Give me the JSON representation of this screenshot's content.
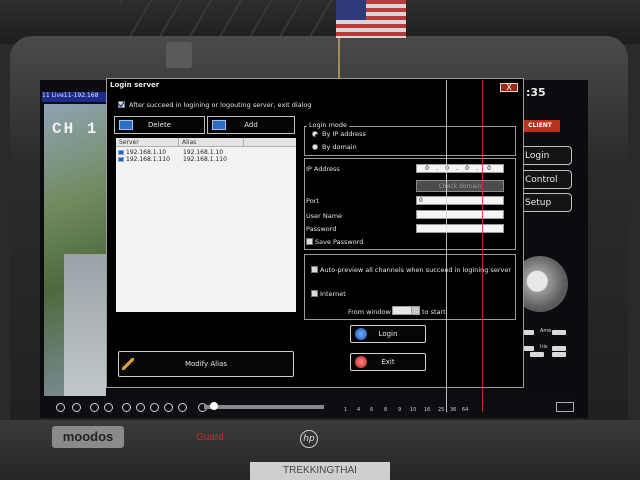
{
  "background_app": {
    "cam_title": "11 Live11-192.168",
    "channel_label": "CH 1",
    "time": ":35",
    "client_logo": "CLIENT",
    "side_buttons": [
      "Login",
      "Control",
      "Setup"
    ],
    "keypad_labels": [
      "Ame",
      "Iris"
    ],
    "grid_numbers": [
      "1",
      "4",
      "6",
      "8",
      "9",
      "10",
      "16",
      "25",
      "36",
      "64"
    ]
  },
  "dialog": {
    "title": "Login server",
    "close_label": "X",
    "exit_on_success_label": "After succeed in logining or logouting server, exit dialog",
    "exit_on_success_checked": true,
    "delete_label": "Delete",
    "add_label": "Add",
    "server_list": {
      "columns": [
        "Server",
        "Alias"
      ],
      "rows": [
        {
          "server": "192.168.1.10",
          "alias": "192.168.1.10"
        },
        {
          "server": "192.168.1.110",
          "alias": "192.168.1.110"
        }
      ]
    },
    "login_mode": {
      "title": "Login mode",
      "options": [
        "By IP address",
        "By domain"
      ],
      "selected": "By IP address"
    },
    "fields": {
      "ip_label": "IP Address",
      "ip_segments": [
        "0",
        "0",
        "0",
        "0"
      ],
      "check_domain_label": "Check domain",
      "port_label": "Port",
      "port_value": "0",
      "username_label": "User Name",
      "username_value": "",
      "password_label": "Password",
      "password_value": "",
      "save_password_label": "Save Password",
      "save_password_checked": false
    },
    "options": {
      "auto_preview_label": "Auto-preview all channels when succeed in logining server",
      "auto_preview_checked": false,
      "internet_label": "Internet",
      "internet_checked": false,
      "from_window_label": "From window",
      "to_start_label": "to start",
      "window_value": ""
    },
    "login_label": "Login",
    "exit_label": "Exit",
    "modify_alias_label": "Modify Alias"
  },
  "environment": {
    "bezel_brand": "moodos",
    "mid_brand": "Guard",
    "hp_logo": "hp",
    "sticker": "TREKKINGTHAI"
  },
  "colors": {
    "dialog_bg": "#000000",
    "title_bar_blue": "#1b2c8a",
    "close_red": "#a0261a",
    "list_bg": "#f2f2f2"
  }
}
